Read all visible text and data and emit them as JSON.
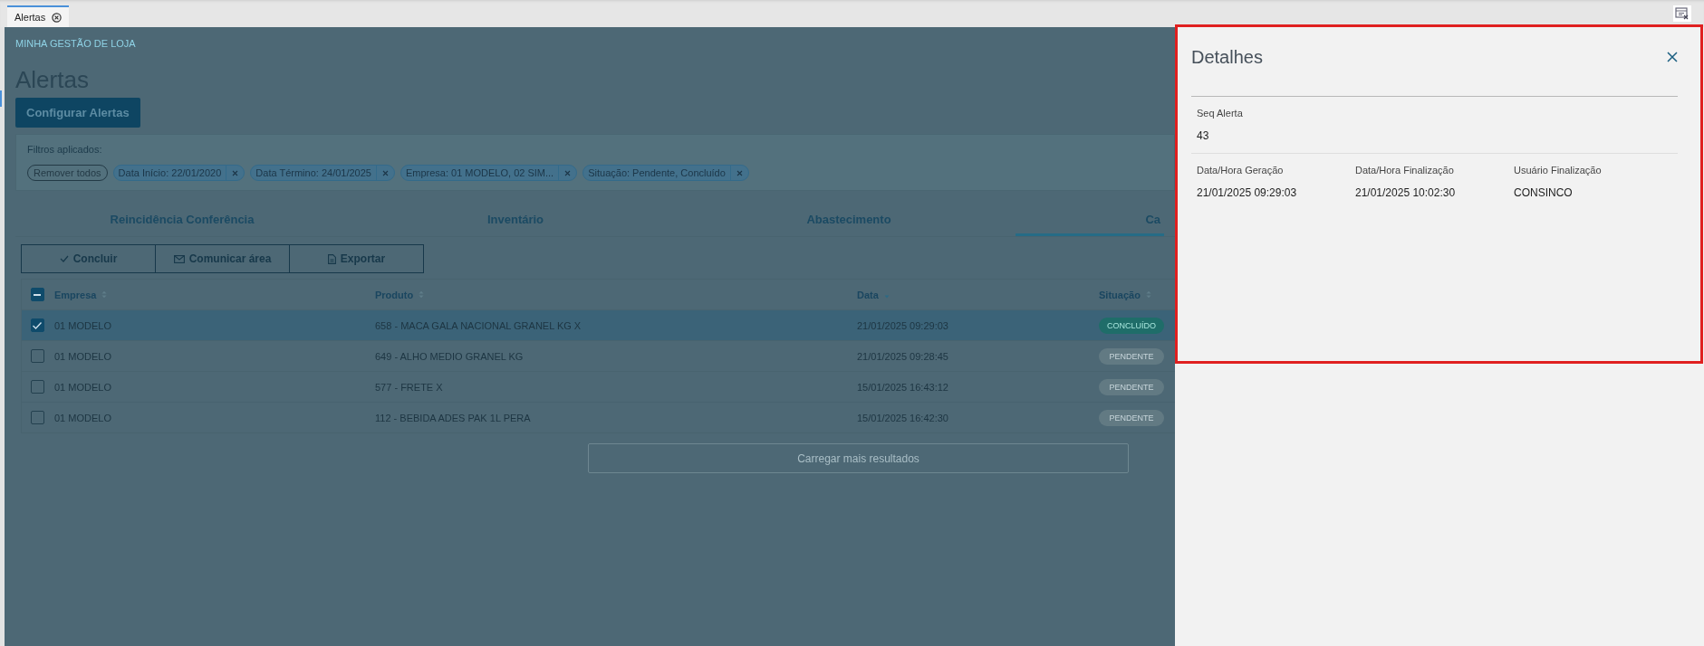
{
  "app_tabs": [
    {
      "label": "Alertas",
      "selected": true
    }
  ],
  "breadcrumb": "MINHA GESTÃO DE LOJA",
  "page_title": "Alertas",
  "configure_button": "Configurar Alertas",
  "filters": {
    "label": "Filtros aplicados:",
    "clear_all": "Remover todos",
    "chips": [
      "Data Início: 22/01/2020",
      "Data Término: 24/01/2025",
      "Empresa: 01 MODELO, 02 SIM...",
      "Situação: Pendente, Concluído"
    ]
  },
  "tabs": [
    {
      "label": "Reincidência Conferência",
      "selected": false
    },
    {
      "label": "Inventário",
      "selected": false
    },
    {
      "label": "Abastecimento",
      "selected": false
    },
    {
      "label": "Ca",
      "selected": true
    }
  ],
  "actions": [
    {
      "kind": "check",
      "label": "Concluir"
    },
    {
      "kind": "mail",
      "label": "Comunicar área"
    },
    {
      "kind": "file",
      "label": "Exportar"
    }
  ],
  "table": {
    "select_all_indeterminate": true,
    "columns": [
      {
        "label": "Empresa",
        "sorted": false
      },
      {
        "label": "Produto",
        "sorted": false
      },
      {
        "label": "Data",
        "sorted": true
      },
      {
        "label": "Situação",
        "sorted": false
      }
    ],
    "rows": [
      {
        "selected": true,
        "empresa": "01 MODELO",
        "produto": "658 - MACA GALA NACIONAL GRANEL KG X",
        "data": "21/01/2025 09:29:03",
        "status": {
          "kind": "done",
          "label": "CONCLUÍDO"
        }
      },
      {
        "selected": false,
        "empresa": "01 MODELO",
        "produto": "649 - ALHO MEDIO GRANEL KG",
        "data": "21/01/2025 09:28:45",
        "status": {
          "kind": "pending",
          "label": "PENDENTE"
        }
      },
      {
        "selected": false,
        "empresa": "01 MODELO",
        "produto": "577 - FRETE X",
        "data": "15/01/2025 16:43:12",
        "status": {
          "kind": "pending",
          "label": "PENDENTE"
        }
      },
      {
        "selected": false,
        "empresa": "01 MODELO",
        "produto": "112 - BEBIDA ADES PAK 1L PERA",
        "data": "15/01/2025 16:42:30",
        "status": {
          "kind": "pending",
          "label": "PENDENTE"
        }
      }
    ]
  },
  "load_more": "Carregar mais resultados",
  "drawer": {
    "title": "Detalhes",
    "sections": [
      [
        {
          "label": "Seq Alerta",
          "value": "43"
        }
      ],
      [
        {
          "label": "Data/Hora Geração",
          "value": "21/01/2025 09:29:03"
        },
        {
          "label": "Data/Hora Finalização",
          "value": "21/01/2025 10:02:30"
        },
        {
          "label": "Usuário Finalização",
          "value": "CONSINCO"
        }
      ]
    ]
  }
}
